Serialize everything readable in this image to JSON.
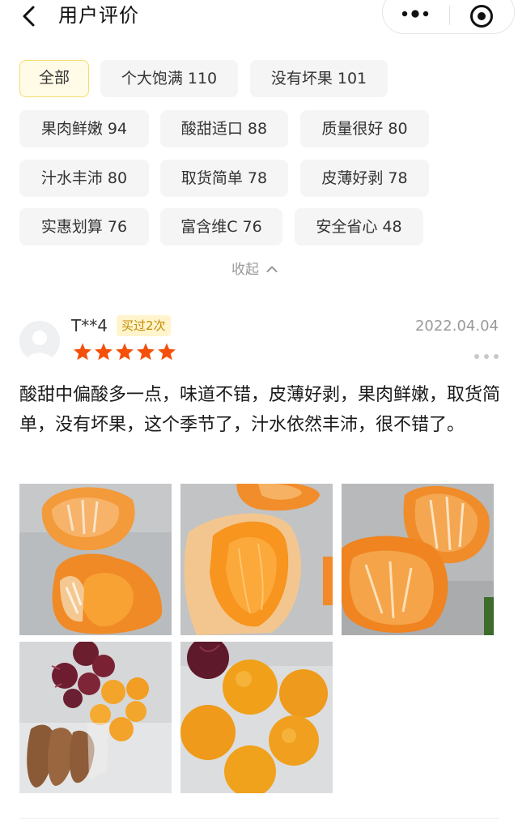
{
  "header": {
    "title": "用户评价"
  },
  "tags": [
    {
      "label": "全部",
      "active": true
    },
    {
      "label": "个大饱满 110"
    },
    {
      "label": "没有坏果 101"
    },
    {
      "label": "果肉鲜嫩 94"
    },
    {
      "label": "酸甜适口 88"
    },
    {
      "label": "质量很好 80"
    },
    {
      "label": "汁水丰沛 80"
    },
    {
      "label": "取货简单 78"
    },
    {
      "label": "皮薄好剥 78"
    },
    {
      "label": "实惠划算 76"
    },
    {
      "label": "富含维C 76"
    },
    {
      "label": "安全省心 48"
    }
  ],
  "collapse_label": "收起",
  "review": {
    "username": "T**4",
    "badge": "买过2次",
    "rating": 5,
    "date": "2022.04.04",
    "text": "酸甜中偏酸多一点，味道不错，皮薄好剥，果肉鲜嫩，取货简单，没有坏果，这个季节了，汁水依然丰沛，很不错了。",
    "photo_count": 5
  },
  "colors": {
    "star": "#f5500a",
    "badge_bg": "#fff4cc",
    "badge_text": "#c48a00",
    "active_tag_bg": "#fffbe6",
    "active_tag_border": "#f5dc6e"
  },
  "icons": [
    "back-arrow-icon",
    "more-dots-icon",
    "close-target-icon",
    "chevron-up-icon",
    "star-icon",
    "ellipsis-icon"
  ]
}
